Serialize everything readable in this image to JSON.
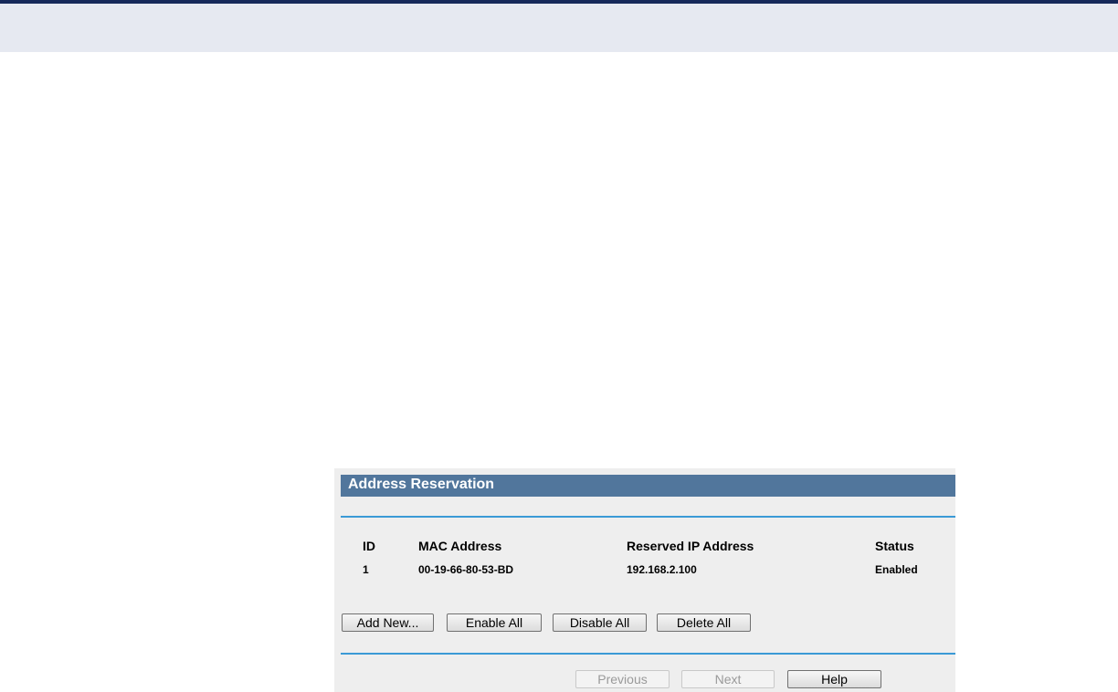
{
  "panel": {
    "title": "Address Reservation"
  },
  "table": {
    "headers": {
      "id": "ID",
      "mac": "MAC Address",
      "ip": "Reserved IP Address",
      "status": "Status"
    },
    "rows": [
      {
        "id": "1",
        "mac": "00-19-66-80-53-BD",
        "ip": "192.168.2.100",
        "status": "Enabled"
      }
    ]
  },
  "actions": {
    "add_new": "Add New...",
    "enable_all": "Enable All",
    "disable_all": "Disable All",
    "delete_all": "Delete All"
  },
  "nav": {
    "previous": "Previous",
    "next": "Next",
    "help": "Help"
  },
  "colors": {
    "header_bar": "#51769c",
    "rule": "#3a9ad6",
    "top_bar": "#e6e9f1",
    "top_rule": "#16295a"
  }
}
